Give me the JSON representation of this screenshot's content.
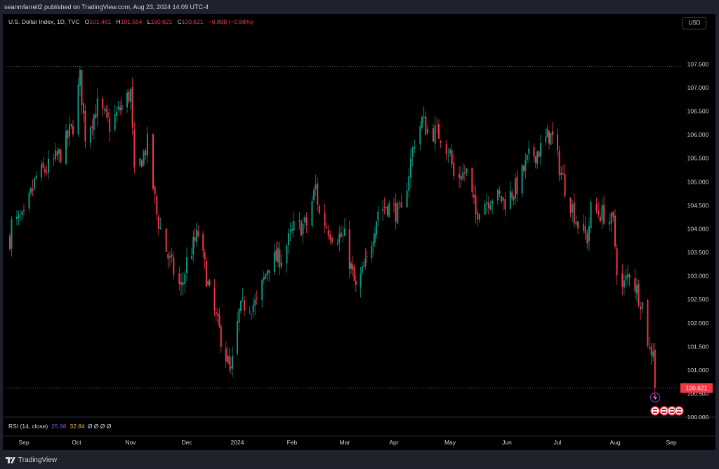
{
  "header": {
    "published_text": "seanmfarrell2 published on TradingView.com, Aug 23, 2024 14:09 UTC-4"
  },
  "legend": {
    "symbol": "U.S. Dollar Index, 1D, TVC",
    "open_label": "O",
    "open_value": "101.461",
    "high_label": "H",
    "high_value": "101.554",
    "low_label": "L",
    "low_value": "100.621",
    "close_label": "C",
    "close_value": "100.621",
    "change": "−0.898 (−0.88%)"
  },
  "currency_button": "USD",
  "rsi": {
    "label": "RSI (14, close)",
    "value": "25.98",
    "ma_value": "32.84",
    "empty_values": "Ø Ø Ø Ø"
  },
  "price_badge": "100.621",
  "footer": {
    "brand": "TradingView"
  },
  "colors": {
    "up": "#089981",
    "down": "#f23645",
    "background": "#000000",
    "frame": "#1e222d"
  },
  "icons": [
    "lightning-icon",
    "us-flag-event-icon"
  ],
  "chart_data": {
    "type": "candlestick",
    "title": "U.S. Dollar Index, 1D, TVC",
    "y_ticks": [
      "107.500",
      "107.000",
      "106.500",
      "106.000",
      "105.500",
      "105.000",
      "104.500",
      "104.000",
      "103.500",
      "103.000",
      "102.500",
      "102.000",
      "101.500",
      "101.000",
      "100.500",
      "100.000"
    ],
    "x_ticks": [
      "Sep",
      "Oct",
      "Nov",
      "Dec",
      "2024",
      "Feb",
      "Mar",
      "Apr",
      "May",
      "Jun",
      "Jul",
      "Aug",
      "Sep"
    ],
    "ylim": [
      99.95,
      107.95
    ],
    "date_range": [
      "2023-08-24",
      "2024-08-23"
    ],
    "grid": false,
    "close_series": [
      [
        "2023-08-24",
        103.8
      ],
      [
        "2023-08-25",
        104.1
      ],
      [
        "2023-09-01",
        104.2
      ],
      [
        "2023-09-08",
        105.1
      ],
      [
        "2023-09-15",
        105.3
      ],
      [
        "2023-09-22",
        105.6
      ],
      [
        "2023-09-29",
        106.2
      ],
      [
        "2023-10-03",
        107.2
      ],
      [
        "2023-10-06",
        106.0
      ],
      [
        "2023-10-13",
        106.6
      ],
      [
        "2023-10-20",
        106.2
      ],
      [
        "2023-10-27",
        106.6
      ],
      [
        "2023-11-01",
        106.9
      ],
      [
        "2023-11-03",
        105.1
      ],
      [
        "2023-11-10",
        105.8
      ],
      [
        "2023-11-15",
        104.3
      ],
      [
        "2023-11-21",
        103.4
      ],
      [
        "2023-11-28",
        102.7
      ],
      [
        "2023-12-01",
        103.3
      ],
      [
        "2023-12-08",
        103.9
      ],
      [
        "2023-12-13",
        103.0
      ],
      [
        "2023-12-15",
        102.6
      ],
      [
        "2023-12-22",
        101.7
      ],
      [
        "2023-12-28",
        100.9
      ],
      [
        "2024-01-02",
        102.2
      ],
      [
        "2024-01-05",
        102.4
      ],
      [
        "2024-01-12",
        102.4
      ],
      [
        "2024-01-19",
        103.3
      ],
      [
        "2024-01-26",
        103.4
      ],
      [
        "2024-02-02",
        104.0
      ],
      [
        "2024-02-09",
        104.1
      ],
      [
        "2024-02-14",
        104.9
      ],
      [
        "2024-02-16",
        104.3
      ],
      [
        "2024-02-23",
        103.9
      ],
      [
        "2024-03-01",
        103.8
      ],
      [
        "2024-03-08",
        102.7
      ],
      [
        "2024-03-15",
        103.3
      ],
      [
        "2024-03-22",
        104.4
      ],
      [
        "2024-03-28",
        104.5
      ],
      [
        "2024-04-05",
        104.3
      ],
      [
        "2024-04-12",
        105.9
      ],
      [
        "2024-04-16",
        106.3
      ],
      [
        "2024-04-19",
        106.1
      ],
      [
        "2024-04-26",
        106.0
      ],
      [
        "2024-05-01",
        105.6
      ],
      [
        "2024-05-03",
        105.1
      ],
      [
        "2024-05-10",
        105.2
      ],
      [
        "2024-05-15",
        104.3
      ],
      [
        "2024-05-17",
        104.5
      ],
      [
        "2024-05-24",
        104.7
      ],
      [
        "2024-05-31",
        104.6
      ],
      [
        "2024-06-07",
        104.9
      ],
      [
        "2024-06-14",
        105.5
      ],
      [
        "2024-06-21",
        105.7
      ],
      [
        "2024-06-26",
        106.0
      ],
      [
        "2024-06-28",
        105.9
      ],
      [
        "2024-07-05",
        104.9
      ],
      [
        "2024-07-12",
        104.1
      ],
      [
        "2024-07-17",
        103.8
      ],
      [
        "2024-07-19",
        104.4
      ],
      [
        "2024-07-26",
        104.3
      ],
      [
        "2024-07-31",
        104.1
      ],
      [
        "2024-08-02",
        103.2
      ],
      [
        "2024-08-05",
        102.7
      ],
      [
        "2024-08-09",
        103.1
      ],
      [
        "2024-08-14",
        102.6
      ],
      [
        "2024-08-16",
        102.4
      ],
      [
        "2024-08-20",
        101.4
      ],
      [
        "2024-08-22",
        101.5
      ],
      [
        "2024-08-23",
        100.621
      ]
    ],
    "last_price": 100.621
  }
}
